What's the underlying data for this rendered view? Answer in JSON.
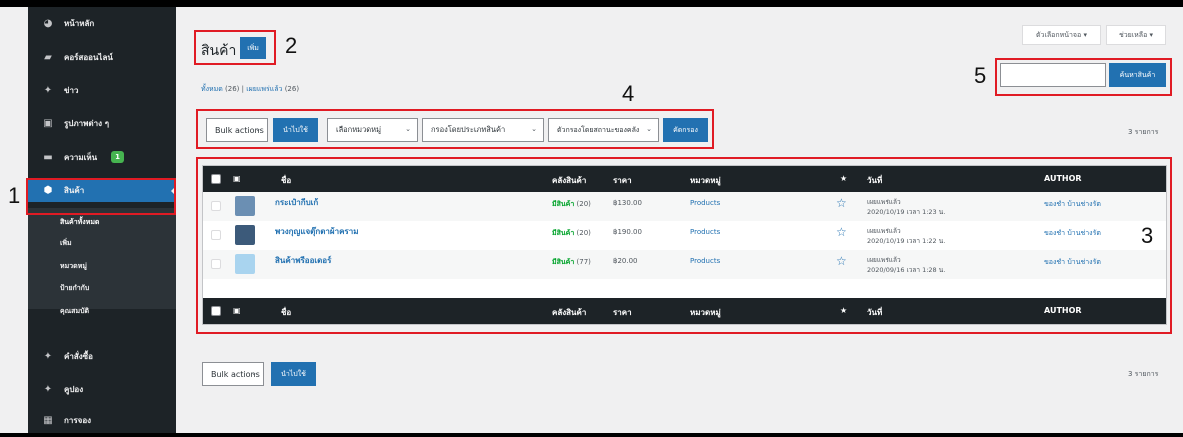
{
  "sidebar": {
    "items": [
      {
        "label": "หน้าหลัก",
        "icon": "dashboard-icon"
      },
      {
        "label": "คอร์สออนไลน์",
        "icon": "graduation-cap-icon"
      },
      {
        "label": "ข่าว",
        "icon": "pin-icon"
      },
      {
        "label": "รูปภาพต่าง ๆ",
        "icon": "media-icon"
      },
      {
        "label": "ความเห็น",
        "icon": "comment-icon",
        "badge": "1"
      },
      {
        "label": "สินค้า",
        "icon": "product-box-icon",
        "active": true
      },
      {
        "label": "คำสั่งซื้อ",
        "icon": "pin-icon"
      },
      {
        "label": "คูปอง",
        "icon": "pin-icon"
      },
      {
        "label": "การจอง",
        "icon": "calendar-icon"
      }
    ],
    "submenu": [
      "สินค้าทั้งหมด",
      "เพิ่ม",
      "หมวดหมู่",
      "ป้ายกำกับ",
      "คุณสมบัติ"
    ]
  },
  "annotations": [
    "1",
    "2",
    "3",
    "4",
    "5"
  ],
  "header": {
    "screen_options": "ตัวเลือกหน้าจอ ▾",
    "help": "ช่วยเหลือ ▾",
    "title": "สินค้า",
    "add_new": "เพิ่ม"
  },
  "views": {
    "all": "ทั้งหมด",
    "all_count": "(26)",
    "sep": "|",
    "published": "เผยแพร่แล้ว",
    "published_count": "(26)"
  },
  "search": {
    "button": "ค้นหาสินค้า",
    "value": ""
  },
  "filters": {
    "bulk_actions": "Bulk actions",
    "apply": "นำไปใช้",
    "category": "เลือกหมวดหมู่",
    "product_type": "กรองโดยประเภทสินค้า",
    "stock_status": "ตัวกรองโดยสถานะของคลัง",
    "filter_btn": "คัดกรอง",
    "items_count": "3 รายการ"
  },
  "table": {
    "columns": {
      "name": "ชื่อ",
      "stock": "คลังสินค้า",
      "price": "ราคา",
      "category": "หมวดหมู่",
      "star": "★",
      "date": "วันที่",
      "author": "AUTHOR"
    },
    "rows": [
      {
        "name": "กระเป๋ากีบเก้",
        "stock": "มีสินค้า",
        "stock_qty": "(20)",
        "price": "฿130.00",
        "category": "Products",
        "status": "เผยแพร่แล้ว",
        "date": "2020/10/19 เวลา 1:23 น.",
        "author": "ของชำ บ้านช่างรัต",
        "thumb_color": "#6b8fb3"
      },
      {
        "name": "พวงกุญแจตุ๊กตาผ้าคราม",
        "stock": "มีสินค้า",
        "stock_qty": "(20)",
        "price": "฿190.00",
        "category": "Products",
        "status": "เผยแพร่แล้ว",
        "date": "2020/10/19 เวลา 1:22 น.",
        "author": "ของชำ บ้านช่างรัต",
        "thumb_color": "#3c5a7a"
      },
      {
        "name": "สินค้าพรีออเดอร์",
        "stock": "มีสินค้า",
        "stock_qty": "(77)",
        "price": "฿20.00",
        "category": "Products",
        "status": "เผยแพร่แล้ว",
        "date": "2020/09/16 เวลา 1:28 น.",
        "author": "ของชำ บ้านช่างรัต",
        "thumb_color": "#a9d4ef"
      }
    ]
  },
  "bottom": {
    "bulk_actions": "Bulk actions",
    "apply": "นำไปใช้",
    "items_count": "3 รายการ"
  },
  "colors": {
    "accent": "#2271b1",
    "sidebar": "#1d2327",
    "annotation": "#e01b24",
    "in_stock": "#00a32a"
  }
}
